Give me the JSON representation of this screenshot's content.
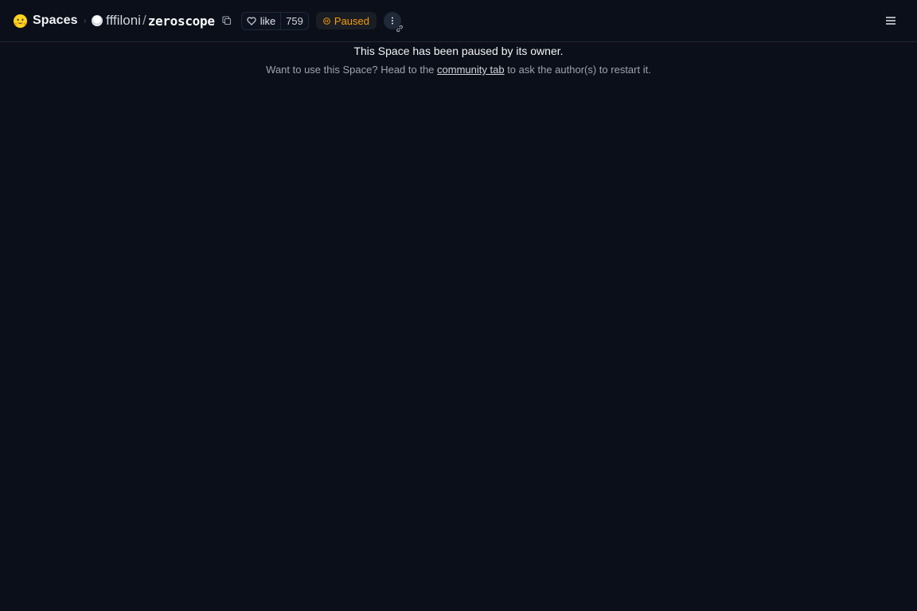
{
  "header": {
    "brand_emoji": "🤗",
    "brand": "Spaces",
    "separator": "ı",
    "owner": "fffiloni",
    "slash": "/",
    "repo": "zeroscope",
    "like_label": "like",
    "like_count": "759",
    "status": "Paused",
    "icons": {
      "logo": "hugging-face-icon",
      "copy": "copy-icon",
      "like": "heart-icon",
      "status": "pause-circle-icon",
      "more": "vertical-dots-icon",
      "link": "link-icon",
      "menu": "hamburger-menu-icon"
    }
  },
  "main": {
    "title": "This Space has been paused by its owner.",
    "subtitle_before": "Want to use this Space? Head to the ",
    "subtitle_link": "community tab",
    "subtitle_after": " to ask the author(s) to restart it."
  },
  "colors": {
    "background": "#0b0f19",
    "status": "#f59e0b",
    "border": "#1f2937"
  }
}
